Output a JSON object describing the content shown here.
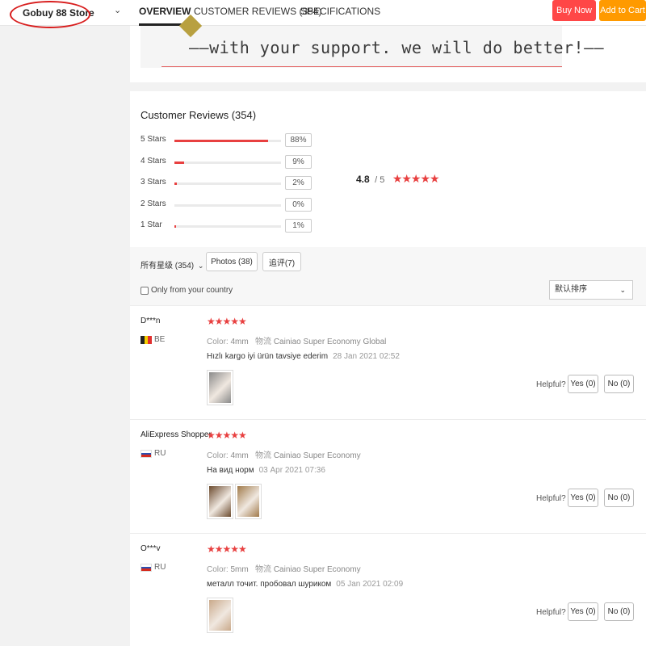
{
  "store": {
    "name": "Gobuy 88 Store",
    "chevron_icon": "chevron-down-icon"
  },
  "tabs": [
    {
      "label": "OVERVIEW",
      "active": true
    },
    {
      "label": "CUSTOMER REVIEWS (354)",
      "active": false
    },
    {
      "label": "SPECIFICATIONS",
      "active": false
    }
  ],
  "actions": {
    "buy_now": "Buy Now",
    "add_to_cart": "Add to Cart"
  },
  "colors": {
    "accent": "#e84040",
    "buy_now": "#ff4747",
    "add_to_cart": "#ff9a00",
    "annotation": "#d81e1e"
  },
  "banner": {
    "text": "——with your support. we will do better!——"
  },
  "reviews_summary": {
    "title": "Customer Reviews (354)",
    "rows": [
      {
        "label": "5 Stars",
        "percent": "88%",
        "fraction": 0.88
      },
      {
        "label": "4 Stars",
        "percent": "9%",
        "fraction": 0.09
      },
      {
        "label": "3 Stars",
        "percent": "2%",
        "fraction": 0.02
      },
      {
        "label": "2 Stars",
        "percent": "0%",
        "fraction": 0.0
      },
      {
        "label": "1 Star",
        "percent": "1%",
        "fraction": 0.01
      }
    ],
    "overall_score": "4.8",
    "overall_of": "/ 5",
    "overall_stars": "★★★★★"
  },
  "filters": {
    "all_ratings": "所有星级 (354)",
    "photos": "Photos (38)",
    "follow_up": "追评(7)",
    "only_country": "Only from your country",
    "sort": "默认排序"
  },
  "reviews": [
    {
      "name": "D***n",
      "country": "BE",
      "flag": [
        "#222222",
        "#f5d000",
        "#e03030"
      ],
      "stars": "★★★★★",
      "color_key": "Color:",
      "color_val": "4mm",
      "ship_key": "物流",
      "ship_val": "Cainiao Super Economy Global",
      "text": "Hızlı kargo iyi ürün tavsiye ederim",
      "date": "28 Jan 2021 02:52",
      "helpful": "Helpful?",
      "yes": "Yes (0)",
      "no": "No (0)",
      "photos": [
        "#8a8a8a"
      ]
    },
    {
      "name": "AliExpress Shopper",
      "country": "RU",
      "flag": [
        "#ffffff",
        "#2b4fb0",
        "#d52b1e"
      ],
      "stars": "★★★★★",
      "color_key": "Color:",
      "color_val": "4mm",
      "ship_key": "物流",
      "ship_val": "Cainiao Super Economy",
      "text": "На вид норм",
      "date": "03 Apr 2021 07:36",
      "helpful": "Helpful?",
      "yes": "Yes (0)",
      "no": "No (0)",
      "photos": [
        "#6b4a2e",
        "#a07a4a"
      ]
    },
    {
      "name": "O***v",
      "country": "RU",
      "flag": [
        "#ffffff",
        "#2b4fb0",
        "#d52b1e"
      ],
      "stars": "★★★★★",
      "color_key": "Color:",
      "color_val": "5mm",
      "ship_key": "物流",
      "ship_val": "Cainiao Super Economy",
      "text": "металл точит. пробовал шурикoм",
      "date": "05 Jan 2021 02:09",
      "helpful": "Helpful?",
      "yes": "Yes (0)",
      "no": "No (0)",
      "photos": [
        "#c9a98a"
      ]
    }
  ]
}
